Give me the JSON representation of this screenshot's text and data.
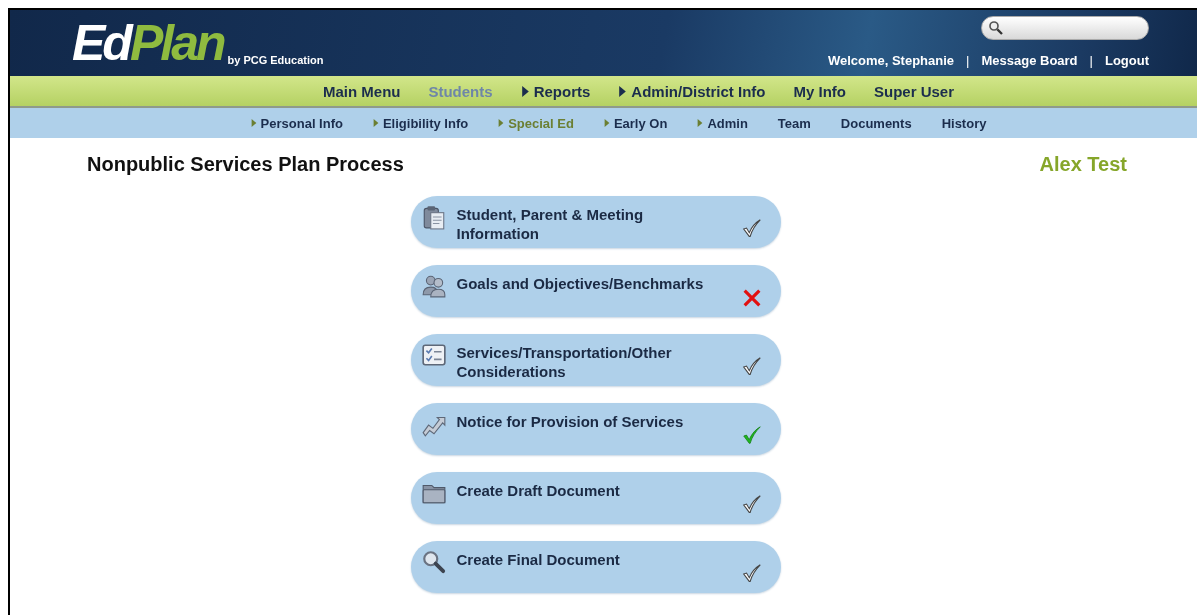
{
  "header": {
    "logo": {
      "primary": "Ed",
      "accent": "Plan",
      "tagline": "by PCG Education"
    },
    "welcome": "Welcome, Stephanie",
    "user_links": [
      {
        "separator": "|",
        "label": "Message Board"
      },
      {
        "separator": "|",
        "label": "Logout"
      }
    ]
  },
  "main_nav": [
    {
      "label": "Main Menu",
      "selected": false,
      "has_submenu": false
    },
    {
      "label": "Students",
      "selected": true,
      "has_submenu": false
    },
    {
      "label": "Reports",
      "selected": false,
      "has_submenu": true
    },
    {
      "label": "Admin/District Info",
      "selected": false,
      "has_submenu": true
    },
    {
      "label": "My Info",
      "selected": false,
      "has_submenu": false
    },
    {
      "label": "Super User",
      "selected": false,
      "has_submenu": false
    }
  ],
  "sub_nav": [
    {
      "label": "Personal Info",
      "selected": false,
      "has_submenu": true
    },
    {
      "label": "Eligibility Info",
      "selected": false,
      "has_submenu": true
    },
    {
      "label": "Special Ed",
      "selected": true,
      "has_submenu": true
    },
    {
      "label": "Early On",
      "selected": false,
      "has_submenu": true
    },
    {
      "label": "Admin",
      "selected": false,
      "has_submenu": true
    },
    {
      "label": "Team",
      "selected": false,
      "has_submenu": false
    },
    {
      "label": "Documents",
      "selected": false,
      "has_submenu": false
    },
    {
      "label": "History",
      "selected": false,
      "has_submenu": false
    }
  ],
  "page": {
    "title": "Nonpublic Services Plan Process",
    "student": "Alex Test"
  },
  "steps": [
    {
      "label": "Student, Parent & Meeting Information",
      "kind": "done"
    },
    {
      "label": "Goals and Objectives/Benchmarks",
      "kind": "error"
    },
    {
      "label": "Services/Transportation/Other Considerations",
      "kind": "done"
    },
    {
      "label": "Notice for Provision of Services",
      "kind": "complete"
    },
    {
      "label": "Create Draft Document",
      "kind": "done"
    },
    {
      "label": "Create Final Document",
      "kind": "done"
    }
  ]
}
